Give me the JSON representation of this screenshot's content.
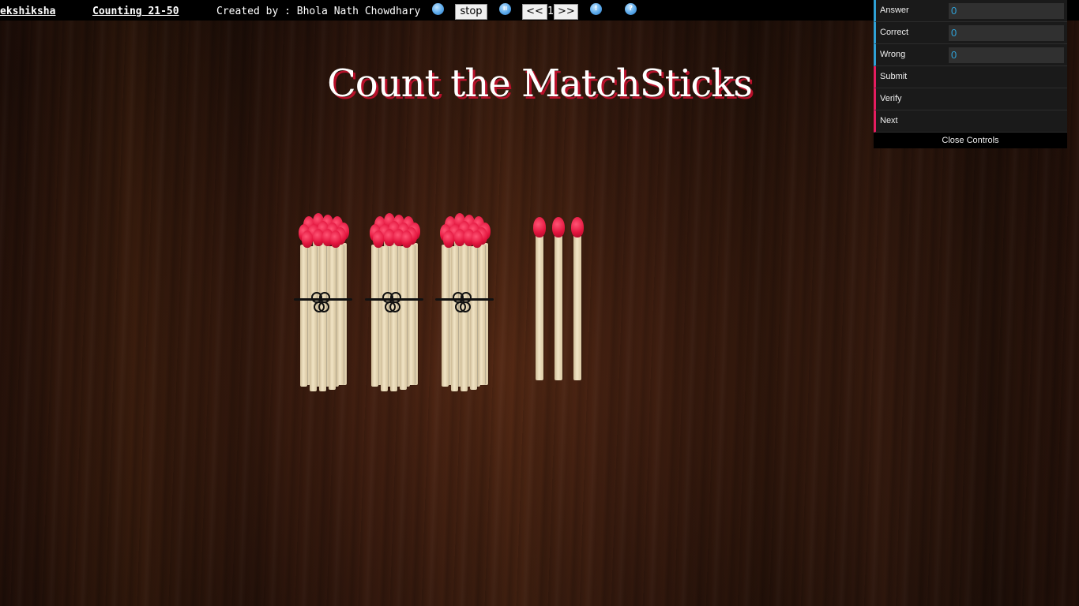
{
  "topbar": {
    "brand": "ekshiksha",
    "section": "Counting 21-50",
    "credit": "Created by : Bhola Nath Chowdhary",
    "stop_label": "stop",
    "pause_icon": "pause-icon",
    "prev_label": "<<",
    "page_number": "1",
    "next_label": ">>",
    "info_icon": "info-icon",
    "help_icon": "help-icon",
    "help_glyph": "?",
    "info_glyph": "!",
    "pause_glyph": "II"
  },
  "title": "Count the MatchSticks",
  "controls": {
    "answer_label": "Answer",
    "answer_value": "0",
    "correct_label": "Correct",
    "correct_value": "0",
    "wrong_label": "Wrong",
    "wrong_value": "0",
    "submit_label": "Submit",
    "verify_label": "Verify",
    "next_label": "Next",
    "close_label": "Close Controls"
  },
  "matchsticks": {
    "bundles_of_ten": 3,
    "loose_sticks": 3
  },
  "colors": {
    "accent_blue": "#2fa1d6",
    "accent_pink": "#e61d5f",
    "match_head": "#e3143d",
    "title_shadow": "#b8102a"
  }
}
